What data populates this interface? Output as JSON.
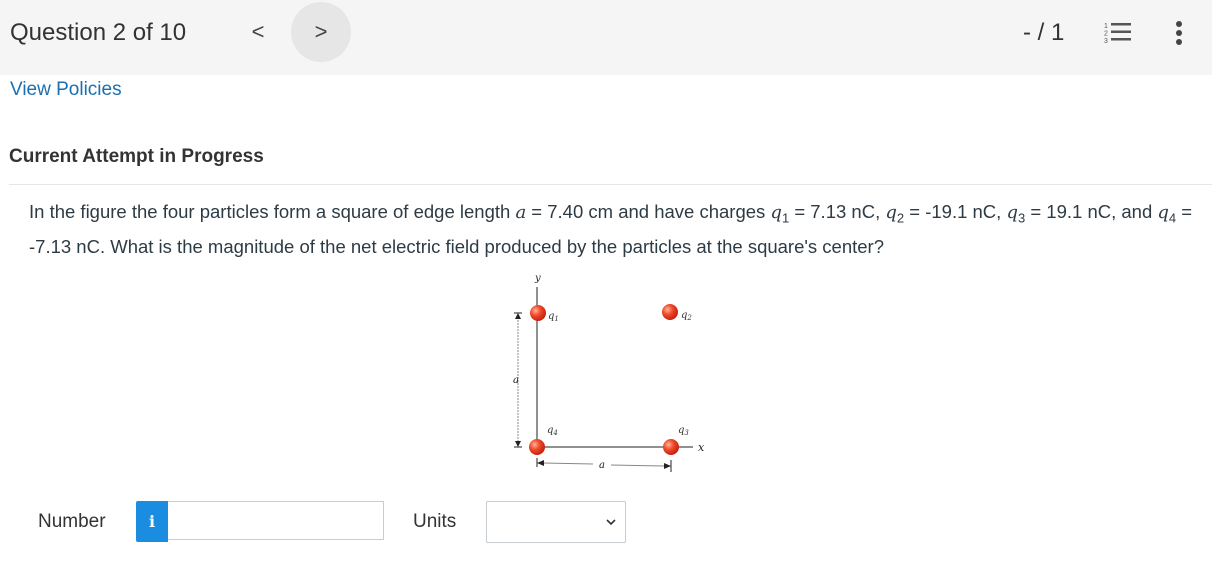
{
  "header": {
    "question_counter": "Question 2 of 10",
    "prev_glyph": "<",
    "next_glyph": ">",
    "score": "- / 1",
    "icons": [
      "list-icon",
      "more-vertical-icon"
    ]
  },
  "links": {
    "view_policies": "View Policies"
  },
  "attempt_status": "Current Attempt in Progress",
  "question": {
    "p1": "In the figure the four particles form a square of edge length ",
    "a_sym": "a",
    "p2": " = 7.40 cm and have charges ",
    "q1": "q",
    "q1_sub": "1",
    "q1_val": " = 7.13 nC, ",
    "q2": "q",
    "q2_sub": "2",
    "q2_val": " = -19.1 nC, ",
    "q3": "q",
    "q3_sub": "3",
    "q3_val": " = 19.1 nC, and ",
    "q4": "q",
    "q4_sub": "4",
    "q4_val": " = -7.13 nC. What is the magnitude of the net electric field produced by the particles at the square's center?"
  },
  "figure": {
    "y_axis": "y",
    "x_axis": "x",
    "edge_label_vertical": "a",
    "edge_label_horizontal": "a",
    "labels": {
      "q1": "q1",
      "q2": "q2",
      "q3": "q3",
      "q4": "q4"
    },
    "charge_color": "#e8321e"
  },
  "answer": {
    "number_label": "Number",
    "info_glyph": "i",
    "number_value": "",
    "units_label": "Units",
    "units_selected": ""
  },
  "colors": {
    "link": "#1b6fb0",
    "info_button": "#1a8de0",
    "topbar": "#f5f5f5"
  }
}
